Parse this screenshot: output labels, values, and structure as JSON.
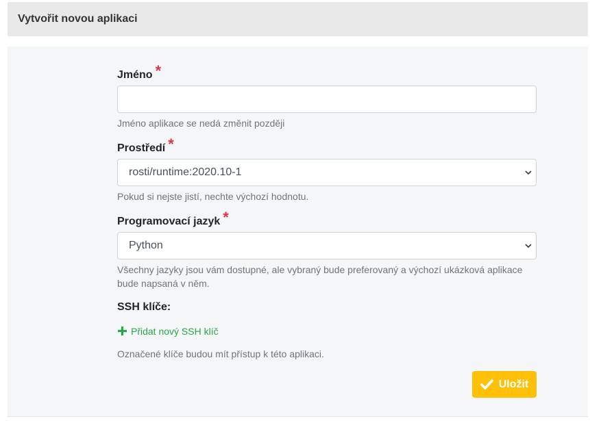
{
  "header": {
    "title": "Vytvořit novou aplikaci"
  },
  "form": {
    "name": {
      "label": "Jméno",
      "required_mark": "*",
      "value": "",
      "placeholder": "",
      "help": "Jméno aplikace se nedá změnit později"
    },
    "environment": {
      "label": "Prostředí",
      "required_mark": "*",
      "selected": "rosti/runtime:2020.10-1",
      "help": "Pokud si nejste jistí, nechte výchozí hodnotu."
    },
    "language": {
      "label": "Programovací jazyk",
      "required_mark": "*",
      "selected": "Python",
      "help": "Všechny jazyky jsou vám dostupné, ale vybraný bude preferovaný a výchozí ukázková aplikace bude napsaná v něm."
    },
    "ssh": {
      "label": "SSH klíče:",
      "add_link": "Přidat nový SSH klíč",
      "add_icon": "plus-icon",
      "help": "Označené klíče budou mít přístup k této aplikaci."
    },
    "save_button": {
      "label": "Uložit",
      "icon": "check-icon"
    }
  },
  "colors": {
    "accent_button": "#ffc107",
    "required": "#dc3545",
    "link": "#28a745",
    "header_bg": "#e9e9e9",
    "panel_bg": "#f5f6f8"
  }
}
